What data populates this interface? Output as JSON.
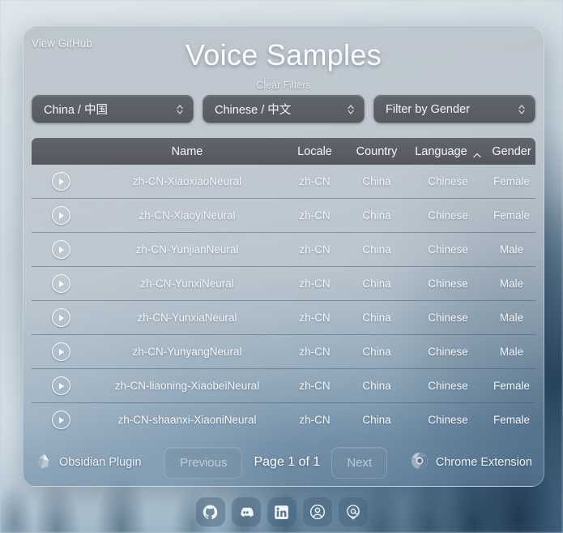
{
  "background": {
    "description": "blurred winter forest photograph",
    "tint": "#7e9bb0"
  },
  "header": {
    "view_github_label": "View GitHub",
    "title": "Voice Samples",
    "clear_filters_label": "Clear Filters"
  },
  "filters": [
    {
      "name": "country-filter",
      "value": "China / 中国",
      "icon": "chevron-updown-icon"
    },
    {
      "name": "language-filter",
      "value": "Chinese / 中文",
      "icon": "chevron-updown-icon"
    },
    {
      "name": "gender-filter",
      "value": "Filter by Gender",
      "icon": "chevron-updown-icon"
    }
  ],
  "table": {
    "columns": [
      {
        "key": "play",
        "label": ""
      },
      {
        "key": "name",
        "label": "Name"
      },
      {
        "key": "locale",
        "label": "Locale"
      },
      {
        "key": "country",
        "label": "Country"
      },
      {
        "key": "language",
        "label": "Language"
      },
      {
        "key": "gender",
        "label": "Gender"
      }
    ],
    "sorted_by": "Language",
    "sort_direction": "ascending",
    "sort_icon": "chevron-up-icon",
    "row_play_icon": "play-circle-icon",
    "rows": [
      {
        "name": "zh-CN-XiaoxiaoNeural",
        "locale": "zh-CN",
        "country": "China",
        "language": "Chinese",
        "gender": "Female"
      },
      {
        "name": "zh-CN-XiaoyiNeural",
        "locale": "zh-CN",
        "country": "China",
        "language": "Chinese",
        "gender": "Female"
      },
      {
        "name": "zh-CN-YunjianNeural",
        "locale": "zh-CN",
        "country": "China",
        "language": "Chinese",
        "gender": "Male"
      },
      {
        "name": "zh-CN-YunxiNeural",
        "locale": "zh-CN",
        "country": "China",
        "language": "Chinese",
        "gender": "Male"
      },
      {
        "name": "zh-CN-YunxiaNeural",
        "locale": "zh-CN",
        "country": "China",
        "language": "Chinese",
        "gender": "Male"
      },
      {
        "name": "zh-CN-YunyangNeural",
        "locale": "zh-CN",
        "country": "China",
        "language": "Chinese",
        "gender": "Male"
      },
      {
        "name": "zh-CN-liaoning-XiaobeiNeural",
        "locale": "zh-CN",
        "country": "China",
        "language": "Chinese",
        "gender": "Female"
      },
      {
        "name": "zh-CN-shaanxi-XiaoniNeural",
        "locale": "zh-CN",
        "country": "China",
        "language": "Chinese",
        "gender": "Female"
      }
    ]
  },
  "footer": {
    "obsidian_label": "Obsidian Plugin",
    "obsidian_icon": "obsidian-icon",
    "previous_label": "Previous",
    "page_indicator": "Page 1 of 1",
    "next_label": "Next",
    "chrome_label": "Chrome Extension",
    "chrome_icon": "chrome-icon"
  },
  "social": [
    {
      "name": "github",
      "icon": "github-icon"
    },
    {
      "name": "discord",
      "icon": "discord-icon"
    },
    {
      "name": "linkedin",
      "icon": "linkedin-icon"
    },
    {
      "name": "profile",
      "icon": "user-circle-icon"
    },
    {
      "name": "contact",
      "icon": "at-circle-icon"
    }
  ]
}
